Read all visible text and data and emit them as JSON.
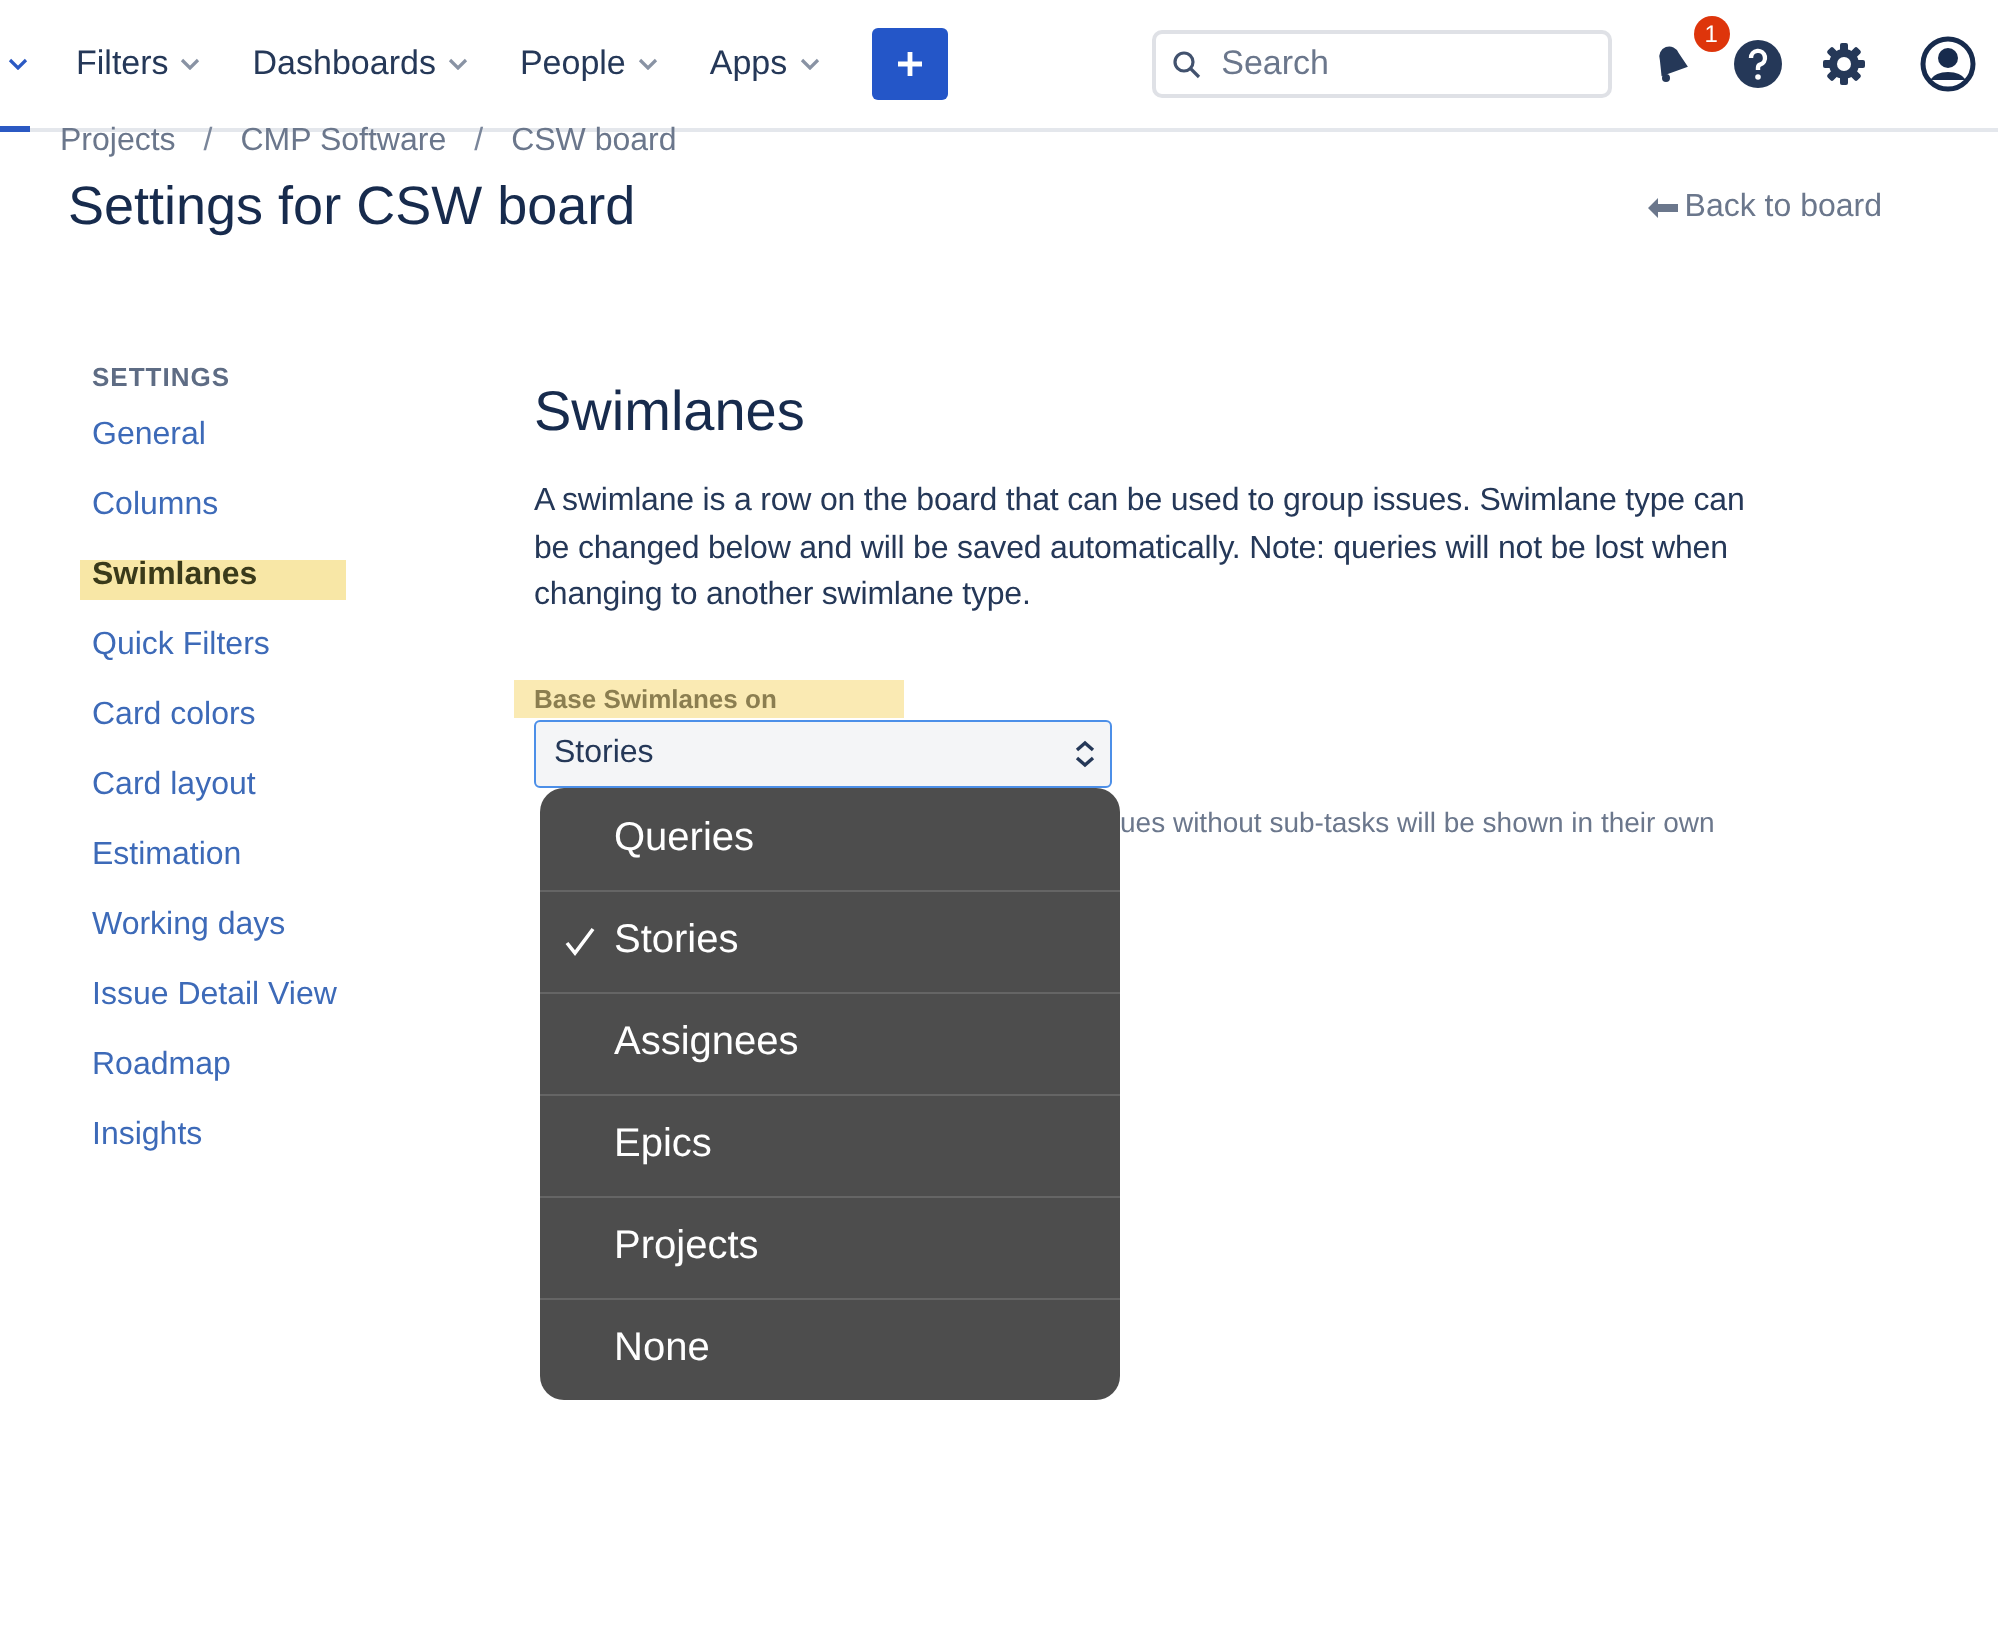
{
  "topnav": {
    "items": [
      {
        "label": "Filters"
      },
      {
        "label": "Dashboards"
      },
      {
        "label": "People"
      },
      {
        "label": "Apps"
      }
    ],
    "search": {
      "placeholder": "Search"
    },
    "notifications": {
      "badge": "1"
    }
  },
  "breadcrumbs": [
    {
      "kind": "link",
      "label": "Projects"
    },
    {
      "kind": "separator",
      "label": "/"
    },
    {
      "kind": "link",
      "label": "CMP Software"
    },
    {
      "kind": "separator",
      "label": "/"
    },
    {
      "kind": "link",
      "label": "CSW board"
    }
  ],
  "page_title": "Settings for CSW board",
  "back_link": "Back to board",
  "sidebar": {
    "heading": "SETTINGS",
    "items": [
      {
        "label": "General",
        "selected": false
      },
      {
        "label": "Columns",
        "selected": false
      },
      {
        "label": "Swimlanes",
        "selected": true
      },
      {
        "label": "Quick Filters",
        "selected": false
      },
      {
        "label": "Card colors",
        "selected": false
      },
      {
        "label": "Card layout",
        "selected": false
      },
      {
        "label": "Estimation",
        "selected": false
      },
      {
        "label": "Working days",
        "selected": false
      },
      {
        "label": "Issue Detail View",
        "selected": false
      },
      {
        "label": "Roadmap",
        "selected": false
      },
      {
        "label": "Insights",
        "selected": false
      }
    ]
  },
  "section": {
    "title": "Swimlanes",
    "description": "A swimlane is a row on the board that can be used to group issues. Swimlane type can be changed below and will be saved automatically. Note: queries will not be lost when changing to another swimlane type.",
    "field": {
      "label": "Base Swimlanes on",
      "label_highlighted": true,
      "value": "Stories",
      "hint": "ues without sub-tasks will be shown in their own"
    },
    "menu": [
      {
        "label": "Queries",
        "selected": false
      },
      {
        "label": "Stories",
        "selected": true
      },
      {
        "label": "Assignees",
        "selected": false
      },
      {
        "label": "Epics",
        "selected": false
      },
      {
        "label": "Projects",
        "selected": false
      },
      {
        "label": "None",
        "selected": false
      }
    ]
  }
}
